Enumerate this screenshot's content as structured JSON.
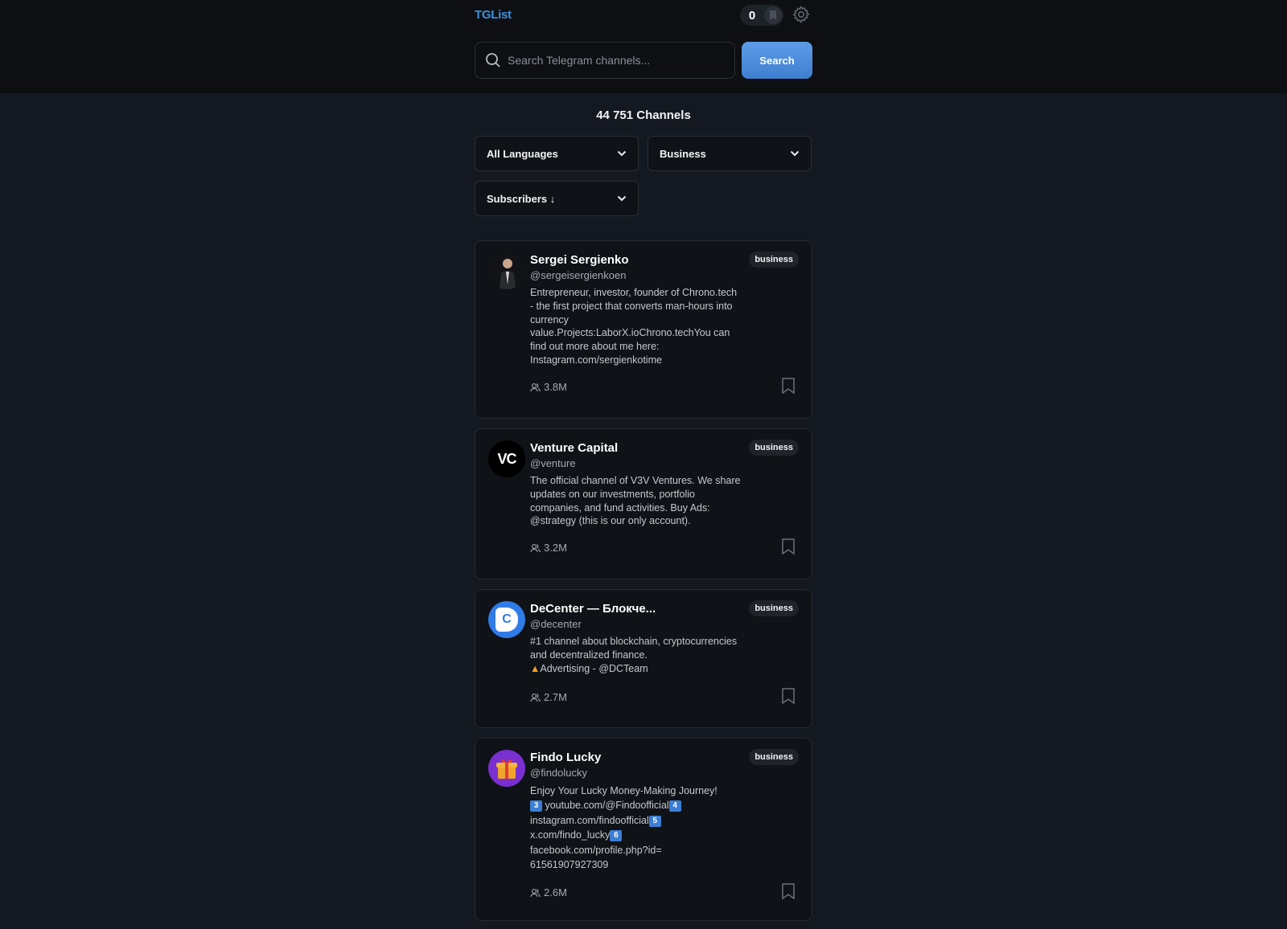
{
  "header": {
    "brand": "TGList",
    "saved_count": "0",
    "search_placeholder": "Search Telegram channels...",
    "search_button": "Search"
  },
  "summary": {
    "count_label": "44 751 Channels"
  },
  "filters": {
    "language": "All Languages",
    "category": "Business",
    "sort": "Subscribers ↓"
  },
  "channels": [
    {
      "title": "Sergei Sergienko",
      "handle": "@sergeisergienkoen",
      "tag": "business",
      "description": "Entrepreneur, investor, founder of Chrono.tech - the first project that converts man-hours into currency value.Projects:LaborX.ioChrono.techYou can find out more about me here: Instagram.com/sergienkotime",
      "subscribers": "3.8M",
      "avatar": "portrait"
    },
    {
      "title": "Venture Capital",
      "handle": "@venture",
      "tag": "business",
      "description": "The official channel of V3V Ventures. We share updates on our investments, portfolio companies, and fund activities. Buy Ads: @strategy (this is our only account).",
      "subscribers": "3.2M",
      "avatar_text": "VC"
    },
    {
      "title": "DeCenter — Блокче...",
      "handle": "@decenter",
      "tag": "business",
      "description_line1": "#1 channel about blockchain, cryptocurrencies and decentralized finance.",
      "description_line2": "Advertising - @DCTeam",
      "subscribers": "2.7M",
      "avatar_text": "C"
    },
    {
      "title": "Findo Lucky",
      "handle": "@findolucky",
      "tag": "business",
      "desc_intro": "Enjoy Your Lucky Money-Making Journey!",
      "links": [
        {
          "badge": "3",
          "text": "youtube.com/@Findoofficial"
        },
        {
          "badge": "4",
          "text": "instagram.com/findoofficial"
        },
        {
          "badge": "5",
          "text": "x.com/findo_lucky"
        },
        {
          "badge": "6",
          "text": "facebook.com/profile.php?id=61561907927309"
        }
      ],
      "subscribers": "2.6M",
      "avatar": "gift-emoji"
    }
  ],
  "colors": {
    "accent": "#3d8fe0",
    "button": "#4a8ad8",
    "background": "#141820",
    "card": "#0f1216"
  }
}
